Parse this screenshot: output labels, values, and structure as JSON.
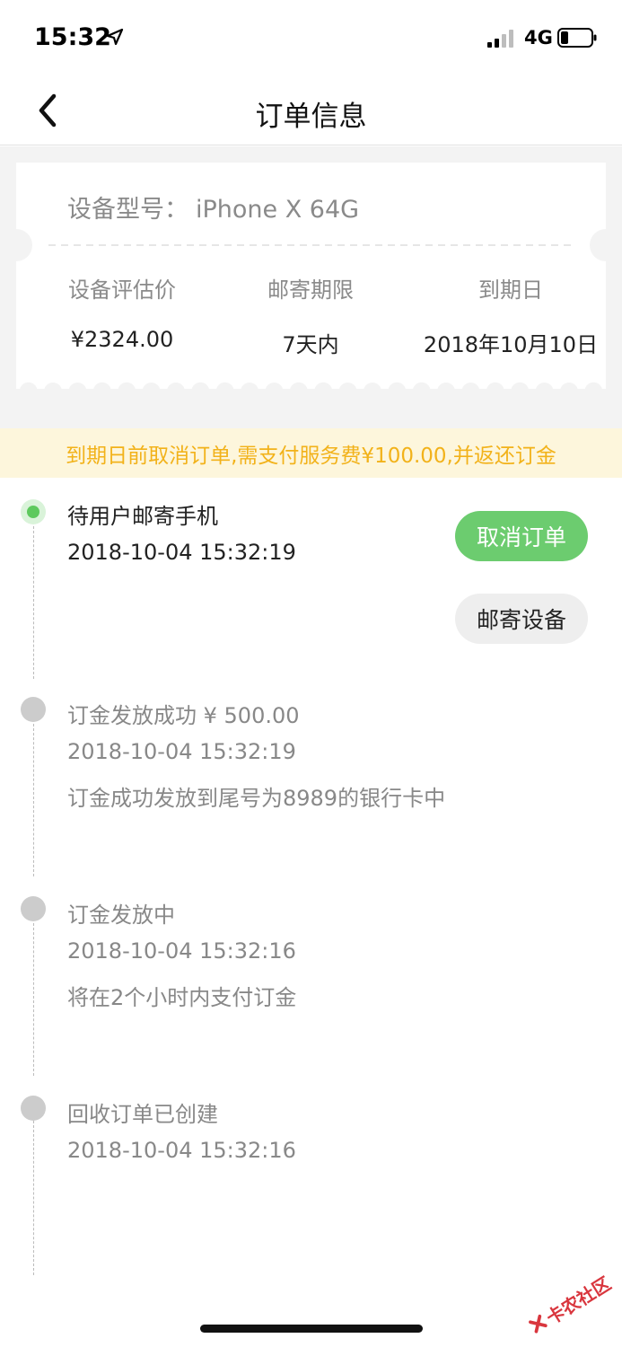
{
  "status_bar": {
    "time": "15:32",
    "network": "4G"
  },
  "nav": {
    "title": "订单信息"
  },
  "ticket": {
    "device_label": "设备型号：",
    "device_value": "iPhone X  64G",
    "columns": [
      {
        "label": "设备评估价",
        "value": "¥2324.00"
      },
      {
        "label": "邮寄期限",
        "value": "7天内"
      },
      {
        "label": "到期日",
        "value": "2018年10月10日"
      }
    ]
  },
  "notice": {
    "text": "到期日前取消订单,需支付服务费¥100.00,并返还订金"
  },
  "timeline": [
    {
      "title": "待用户邮寄手机",
      "time": "2018-10-04 15:32:19",
      "active": true
    },
    {
      "title": "订金发放成功 ¥ 500.00",
      "time": "2018-10-04 15:32:19",
      "desc": "订金成功发放到尾号为8989的银行卡中",
      "active": false
    },
    {
      "title": "订金发放中",
      "time": "2018-10-04 15:32:16",
      "desc": "将在2个小时内支付订金",
      "active": false
    },
    {
      "title": "回收订单已创建",
      "time": "2018-10-04 15:32:16",
      "active": false
    }
  ],
  "actions": {
    "cancel_label": "取消订单",
    "ship_label": "邮寄设备"
  },
  "watermark": {
    "text": "卡农社区"
  },
  "colors": {
    "accent_green": "#6ccc6f",
    "notice_text": "#f2b21a",
    "notice_bg": "#fdf6dc",
    "watermark_red": "#d9363e"
  }
}
